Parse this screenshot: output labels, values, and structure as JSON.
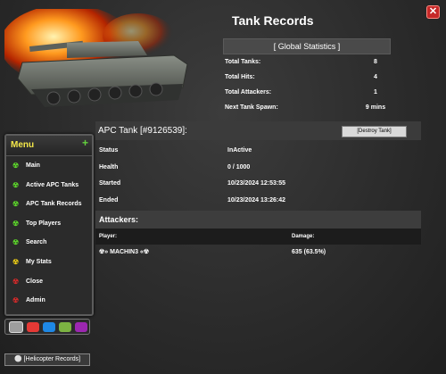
{
  "window": {
    "title": "Tank Records",
    "close_label": "✕"
  },
  "global_stats": {
    "header": "[ Global Statistics ]",
    "rows": [
      {
        "label": "Total Tanks:",
        "value": "8"
      },
      {
        "label": "Total Hits:",
        "value": "4"
      },
      {
        "label": "Total Attackers:",
        "value": "1"
      },
      {
        "label": "Next Tank Spawn:",
        "value": "9 mins"
      }
    ]
  },
  "menu": {
    "title": "Menu",
    "add_label": "+",
    "items": [
      {
        "label": "Main",
        "icon": "radiation-icon",
        "color": "#5cd62a"
      },
      {
        "label": "Active APC Tanks",
        "icon": "radiation-icon",
        "color": "#5cd62a"
      },
      {
        "label": "APC Tank Records",
        "icon": "radiation-icon",
        "color": "#5cd62a"
      },
      {
        "label": "Top Players",
        "icon": "radiation-icon",
        "color": "#5cd62a"
      },
      {
        "label": "Search",
        "icon": "radiation-icon",
        "color": "#5cd62a"
      },
      {
        "label": "My Stats",
        "icon": "radiation-icon",
        "color": "#e8c915"
      },
      {
        "label": "Close",
        "icon": "radiation-icon",
        "color": "#d42a2a"
      },
      {
        "label": "Admin",
        "icon": "radiation-icon",
        "color": "#d42a2a"
      }
    ]
  },
  "theme_swatches": [
    "#9e9e9e",
    "#e53935",
    "#1e88e5",
    "#7cb342",
    "#9c27b0"
  ],
  "helicopter_button": "⚪ [Helicopter Records]",
  "tank_detail": {
    "heading": "APC Tank [#9126539]:",
    "destroy_label": "[Destroy Tank]",
    "rows": [
      {
        "label": "Status",
        "value": "InActive"
      },
      {
        "label": "Health",
        "value": "0 / 1000"
      },
      {
        "label": "Started",
        "value": "10/23/2024 12:53:55"
      },
      {
        "label": "Ended",
        "value": "10/23/2024 13:26:42"
      }
    ]
  },
  "attackers": {
    "heading": "Attackers:",
    "col_player": "Player:",
    "col_damage": "Damage:",
    "rows": [
      {
        "player": "☢» MACHIN3 «☢",
        "damage": "635 (63.5%)"
      }
    ]
  }
}
